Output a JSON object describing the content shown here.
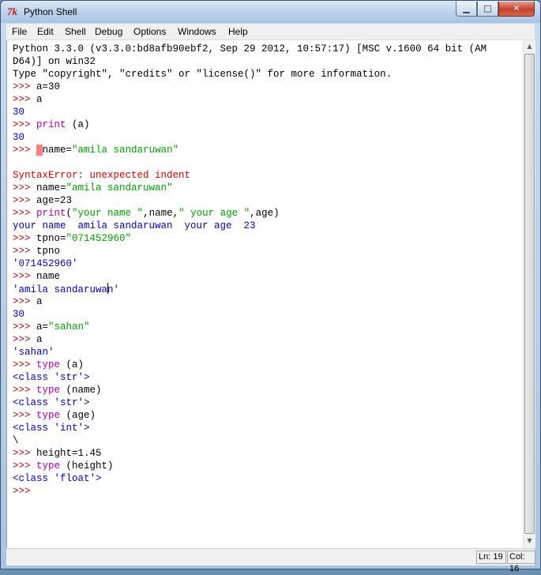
{
  "window": {
    "title": "Python Shell",
    "app_icon": "tk-feather-icon"
  },
  "window_controls": {
    "minimize": "▁",
    "maximize": "□",
    "close": "✕"
  },
  "menu": [
    "File",
    "Edit",
    "Shell",
    "Debug",
    "Options",
    "Windows",
    "Help"
  ],
  "shell_lines": [
    [
      {
        "t": "code",
        "v": "Python 3.3.0 (v3.3.0:bd8afb90ebf2, Sep 29 2012, 10:57:17) [MSC v.1600 64 bit (AM"
      }
    ],
    [
      {
        "t": "code",
        "v": "D64)] on win32"
      }
    ],
    [
      {
        "t": "code",
        "v": "Type \"copyright\", \"credits\" or \"license()\" for more information."
      }
    ],
    [
      {
        "t": "prompt",
        "v": ">>> "
      },
      {
        "t": "code",
        "v": "a=30"
      }
    ],
    [
      {
        "t": "prompt",
        "v": ">>> "
      },
      {
        "t": "code",
        "v": "a"
      }
    ],
    [
      {
        "t": "out",
        "v": "30"
      }
    ],
    [
      {
        "t": "prompt",
        "v": ">>> "
      },
      {
        "t": "kw",
        "v": "print"
      },
      {
        "t": "code",
        "v": " (a)"
      }
    ],
    [
      {
        "t": "out",
        "v": "30"
      }
    ],
    [
      {
        "t": "prompt",
        "v": ">>> "
      },
      {
        "t": "hl",
        "v": " "
      },
      {
        "t": "code",
        "v": "name="
      },
      {
        "t": "str",
        "v": "\"amila sandaruwan\""
      }
    ],
    [],
    [
      {
        "t": "err",
        "v": "SyntaxError: unexpected indent"
      }
    ],
    [
      {
        "t": "prompt",
        "v": ">>> "
      },
      {
        "t": "code",
        "v": "name="
      },
      {
        "t": "str",
        "v": "\"amila sandaruwan\""
      }
    ],
    [
      {
        "t": "prompt",
        "v": ">>> "
      },
      {
        "t": "code",
        "v": "age=23"
      }
    ],
    [
      {
        "t": "prompt",
        "v": ">>> "
      },
      {
        "t": "kw",
        "v": "print"
      },
      {
        "t": "code",
        "v": "("
      },
      {
        "t": "str",
        "v": "\"your name \""
      },
      {
        "t": "code",
        "v": ",name,"
      },
      {
        "t": "str",
        "v": "\" your age \""
      },
      {
        "t": "code",
        "v": ",age)"
      }
    ],
    [
      {
        "t": "out",
        "v": "your name  amila sandaruwan  your age  23"
      }
    ],
    [
      {
        "t": "prompt",
        "v": ">>> "
      },
      {
        "t": "code",
        "v": "tpno="
      },
      {
        "t": "str",
        "v": "\"071452960\""
      }
    ],
    [
      {
        "t": "prompt",
        "v": ">>> "
      },
      {
        "t": "code",
        "v": "tpno"
      }
    ],
    [
      {
        "t": "out",
        "v": "'071452960'"
      }
    ],
    [
      {
        "t": "prompt",
        "v": ">>> "
      },
      {
        "t": "code",
        "v": "name"
      }
    ],
    [
      {
        "t": "out",
        "v": "'amila sandaruwa"
      },
      {
        "t": "caret",
        "v": ""
      },
      {
        "t": "out",
        "v": "n'"
      }
    ],
    [
      {
        "t": "prompt",
        "v": ">>> "
      },
      {
        "t": "code",
        "v": "a"
      }
    ],
    [
      {
        "t": "out",
        "v": "30"
      }
    ],
    [
      {
        "t": "prompt",
        "v": ">>> "
      },
      {
        "t": "code",
        "v": "a="
      },
      {
        "t": "str",
        "v": "\"sahan\""
      }
    ],
    [
      {
        "t": "prompt",
        "v": ">>> "
      },
      {
        "t": "code",
        "v": "a"
      }
    ],
    [
      {
        "t": "out",
        "v": "'sahan'"
      }
    ],
    [
      {
        "t": "prompt",
        "v": ">>> "
      },
      {
        "t": "kw",
        "v": "type"
      },
      {
        "t": "code",
        "v": " (a)"
      }
    ],
    [
      {
        "t": "out",
        "v": "<class 'str'>"
      }
    ],
    [
      {
        "t": "prompt",
        "v": ">>> "
      },
      {
        "t": "kw",
        "v": "type"
      },
      {
        "t": "code",
        "v": " (name)"
      }
    ],
    [
      {
        "t": "out",
        "v": "<class 'str'>"
      }
    ],
    [
      {
        "t": "prompt",
        "v": ">>> "
      },
      {
        "t": "kw",
        "v": "type"
      },
      {
        "t": "code",
        "v": " (age)"
      }
    ],
    [
      {
        "t": "out",
        "v": "<class 'int'>"
      }
    ],
    [
      {
        "t": "code",
        "v": "\\"
      }
    ],
    [
      {
        "t": "prompt",
        "v": ">>> "
      },
      {
        "t": "code",
        "v": "height=1.45"
      }
    ],
    [
      {
        "t": "prompt",
        "v": ">>> "
      },
      {
        "t": "kw",
        "v": "type"
      },
      {
        "t": "code",
        "v": " (height)"
      }
    ],
    [
      {
        "t": "out",
        "v": "<class 'float'>"
      }
    ],
    [
      {
        "t": "prompt",
        "v": ">>> "
      }
    ]
  ],
  "status": {
    "line": "Ln: 19",
    "column": "Col: 16"
  },
  "scrollbar": {
    "up_arrow": "▲",
    "down_arrow": "▼"
  }
}
